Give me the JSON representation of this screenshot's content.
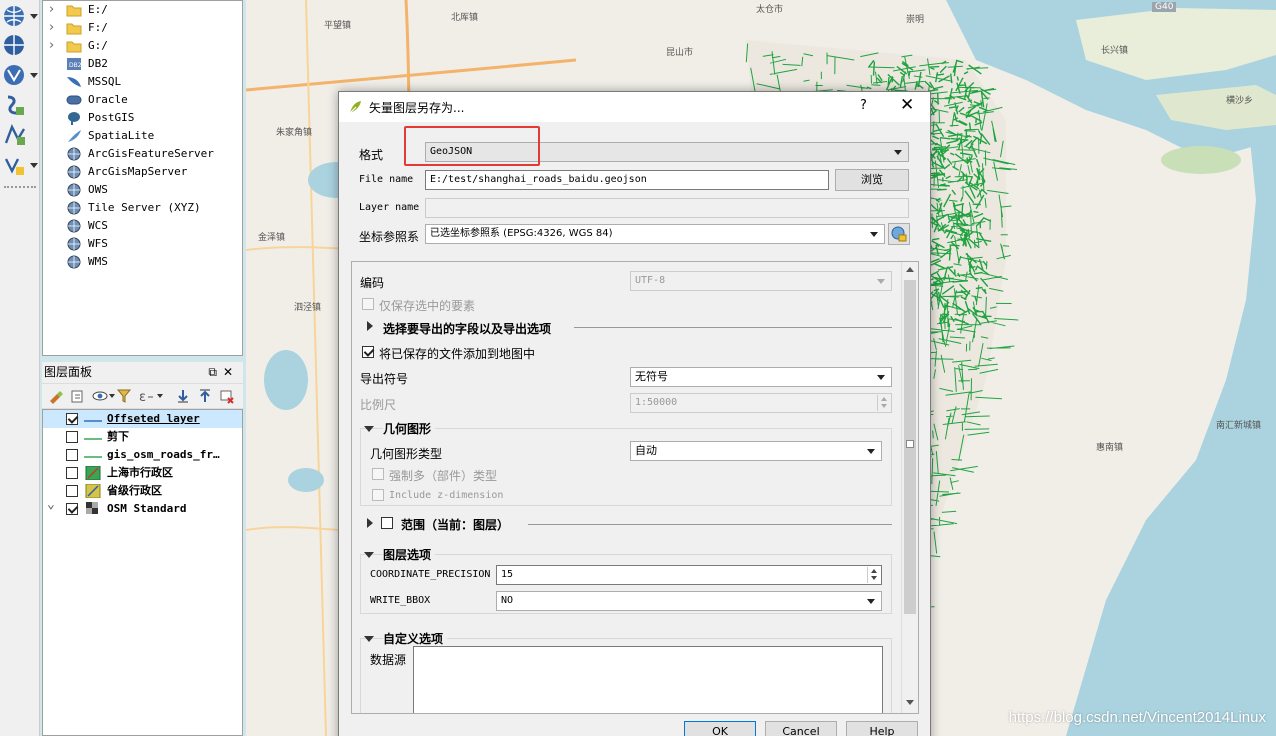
{
  "browser": {
    "items": [
      {
        "label": "E:/",
        "icon": "folder-icon",
        "expandable": true
      },
      {
        "label": "F:/",
        "icon": "folder-icon",
        "expandable": true
      },
      {
        "label": "G:/",
        "icon": "folder-icon",
        "expandable": true
      },
      {
        "label": "DB2",
        "icon": "db2-icon",
        "expandable": false
      },
      {
        "label": "MSSQL",
        "icon": "mssql-icon",
        "expandable": false
      },
      {
        "label": "Oracle",
        "icon": "oracle-icon",
        "expandable": false
      },
      {
        "label": "PostGIS",
        "icon": "postgis-icon",
        "expandable": false
      },
      {
        "label": "SpatiaLite",
        "icon": "spatialite-icon",
        "expandable": false
      },
      {
        "label": "ArcGisFeatureServer",
        "icon": "globe-icon",
        "expandable": false
      },
      {
        "label": "ArcGisMapServer",
        "icon": "globe-icon",
        "expandable": false
      },
      {
        "label": "OWS",
        "icon": "globe-icon",
        "expandable": false
      },
      {
        "label": "Tile Server (XYZ)",
        "icon": "globe-icon",
        "expandable": false
      },
      {
        "label": "WCS",
        "icon": "globe-icon",
        "expandable": false
      },
      {
        "label": "WFS",
        "icon": "globe-icon",
        "expandable": false
      },
      {
        "label": "WMS",
        "icon": "globe-icon",
        "expandable": false
      }
    ]
  },
  "layers_panel": {
    "title": "图层面板",
    "layers": [
      {
        "label": "Offseted layer",
        "checked": true,
        "selected": true,
        "symbol": "line-blue"
      },
      {
        "label": "剪下",
        "checked": false,
        "selected": false,
        "symbol": "line-green"
      },
      {
        "label": "gis_osm_roads_fr…",
        "checked": false,
        "selected": false,
        "symbol": "line-green"
      },
      {
        "label": "上海市行政区",
        "checked": false,
        "selected": false,
        "symbol": "polygon-green"
      },
      {
        "label": "省级行政区",
        "checked": false,
        "selected": false,
        "symbol": "polygon-yellow"
      },
      {
        "label": "OSM Standard",
        "checked": true,
        "selected": false,
        "symbol": "raster",
        "expandable": true
      }
    ]
  },
  "dialog": {
    "title": "矢量图层另存为...",
    "help": "?",
    "close": "✕",
    "format_label": "格式",
    "format_value": "GeoJSON",
    "filename_label": "File name",
    "filename_value": "E:/test/shanghai_roads_baidu.geojson",
    "browse_label": "浏览",
    "layername_label": "Layer name",
    "layername_value": "",
    "crs_label": "坐标参照系",
    "crs_value": "已选坐标参照系 (EPSG:4326, WGS 84)",
    "encoding_label": "编码",
    "encoding_value": "UTF-8",
    "save_selected_label": "仅保存选中的要素",
    "select_fields_label": "选择要导出的字段以及导出选项",
    "add_to_map_label": "将已保存的文件添加到地图中",
    "symbology_label": "导出符号",
    "symbology_value": "无符号",
    "scale_label": "比例尺",
    "scale_value": "1:50000",
    "geometry_header": "几何图形",
    "geometry_type_label": "几何图形类型",
    "geometry_type_value": "自动",
    "force_multi_label": "强制多（部件）类型",
    "include_z_label": "Include z-dimension",
    "extent_label": "范围（当前：图层）",
    "layer_options_header": "图层选项",
    "coord_precision_label": "COORDINATE_PRECISION",
    "coord_precision_value": "15",
    "write_bbox_label": "WRITE_BBOX",
    "write_bbox_value": "NO",
    "custom_options_header": "自定义选项",
    "datasource_label": "数据源",
    "ok_label": "OK",
    "cancel_label": "Cancel",
    "help_label": "Help"
  },
  "map": {
    "labels": [
      "平望镇",
      "北厍镇",
      "朱家角镇",
      "泗泾镇",
      "金泽镇",
      "南汇新城镇",
      "惠南镇",
      "横沙乡",
      "长兴镇",
      "崇明",
      "昆山市",
      "太仓市",
      "G40"
    ],
    "watermark": "https://blog.csdn.net/Vincent2014Linux",
    "road_color": "#0a9b2e",
    "water_color": "#aad3df"
  }
}
